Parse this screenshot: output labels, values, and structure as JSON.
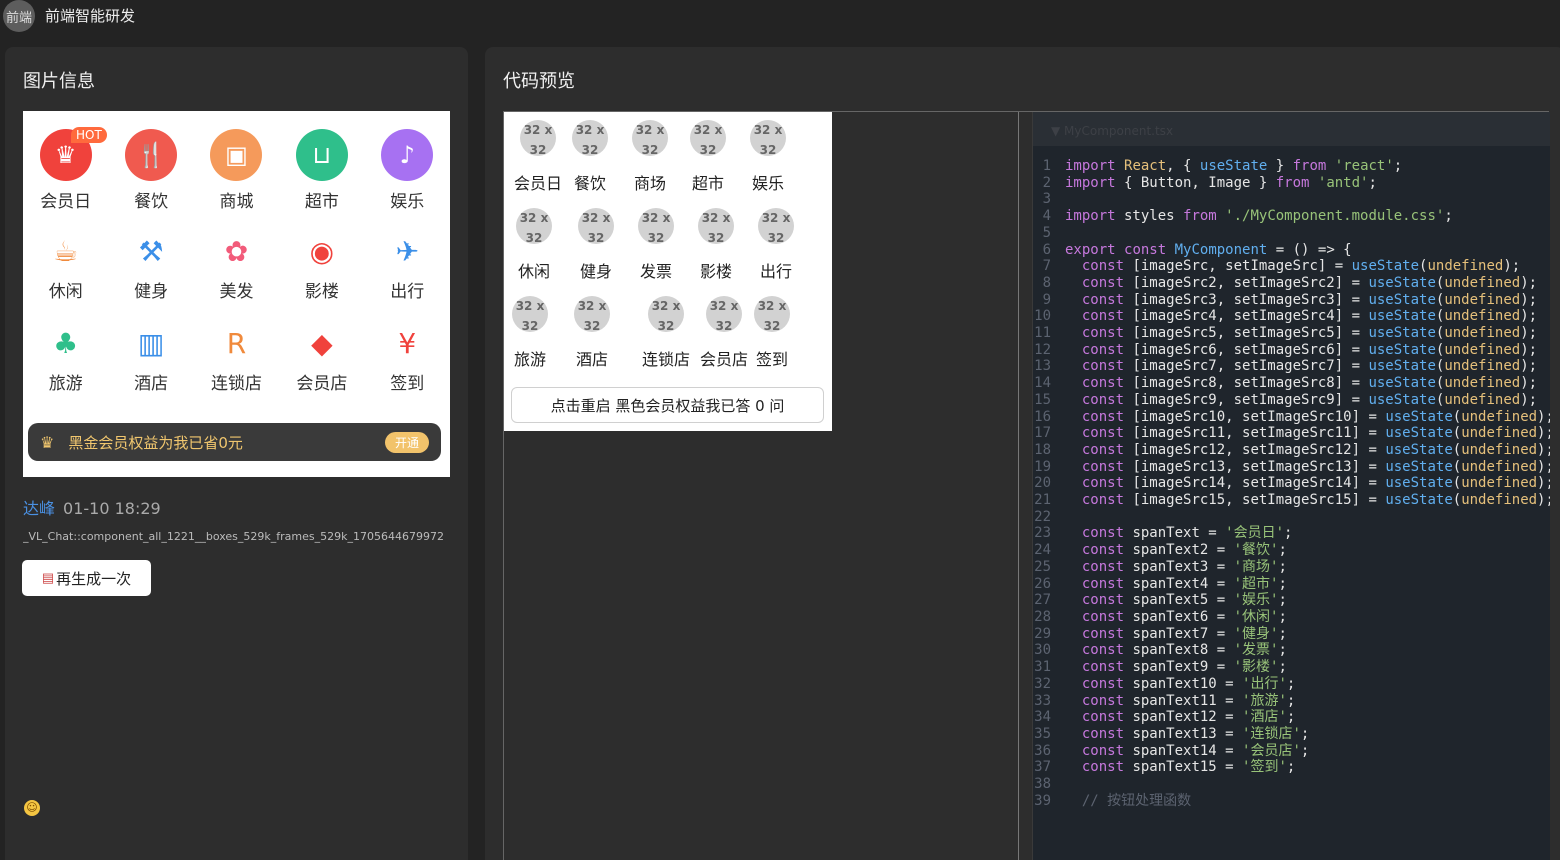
{
  "app": {
    "logo_text": "前端",
    "title": "前端智能研发"
  },
  "left_panel": {
    "title": "图片信息",
    "hot_badge": "HOT",
    "grid": [
      {
        "label": "会员日",
        "icon": "crown-icon",
        "color": "#f0423c",
        "glyph": "♛"
      },
      {
        "label": "餐饮",
        "icon": "fork-knife-icon",
        "color": "#f05a4f",
        "glyph": "🍴"
      },
      {
        "label": "商城",
        "icon": "shopping-bag-icon",
        "color": "#f59a5b",
        "glyph": "▣"
      },
      {
        "label": "超市",
        "icon": "basket-icon",
        "color": "#2fbf8b",
        "glyph": "⊔"
      },
      {
        "label": "娱乐",
        "icon": "microphone-icon",
        "color": "#a771f2",
        "glyph": "♪"
      },
      {
        "label": "休闲",
        "icon": "coffee-icon",
        "color": "#f08a3c",
        "glyph": "☕"
      },
      {
        "label": "健身",
        "icon": "dumbbell-icon",
        "color": "#3b8fe8",
        "glyph": "⚒"
      },
      {
        "label": "美发",
        "icon": "hair-icon",
        "color": "#f25b7a",
        "glyph": "✿"
      },
      {
        "label": "影楼",
        "icon": "camera-icon",
        "color": "#f0423c",
        "glyph": "◉"
      },
      {
        "label": "出行",
        "icon": "airplane-icon",
        "color": "#3b8fe8",
        "glyph": "✈"
      },
      {
        "label": "旅游",
        "icon": "palm-tree-icon",
        "color": "#2fbf8b",
        "glyph": "♣"
      },
      {
        "label": "酒店",
        "icon": "building-icon",
        "color": "#3b8fe8",
        "glyph": "▥"
      },
      {
        "label": "连锁店",
        "icon": "shield-r-icon",
        "color": "#f08a3c",
        "glyph": "R"
      },
      {
        "label": "会员店",
        "icon": "diamond-icon",
        "color": "#f0423c",
        "glyph": "◆"
      },
      {
        "label": "签到",
        "icon": "calendar-yen-icon",
        "color": "#f0423c",
        "glyph": "¥"
      }
    ],
    "vip_text": "黑金会员权益为我已省0元",
    "vip_button": "开通",
    "author": "达峰",
    "timestamp": "01-10 18:29",
    "session_id": "_VL_Chat::component_all_1221__boxes_529k_frames_529k_1705644679972",
    "regen_button": "再生成一次"
  },
  "right_panel": {
    "title": "代码预览",
    "placeholder_text": "32 x 32",
    "render_items": [
      "会员日",
      "餐饮",
      "商场",
      "超市",
      "娱乐",
      "休闲",
      "健身",
      "发票",
      "影楼",
      "出行",
      "旅游",
      "酒店",
      "连锁店",
      "会员店",
      "签到"
    ],
    "render_button": "点击重启 黑色会员权益我已答 0 问",
    "code_header": "▼ MyComponent.tsx",
    "code_lines": [
      "import React, { useState } from 'react';",
      "import { Button, Image } from 'antd';",
      "",
      "import styles from './MyComponent.module.css';",
      "",
      "export const MyComponent = () => {",
      "  const [imageSrc, setImageSrc] = useState(undefined);",
      "  const [imageSrc2, setImageSrc2] = useState(undefined);",
      "  const [imageSrc3, setImageSrc3] = useState(undefined);",
      "  const [imageSrc4, setImageSrc4] = useState(undefined);",
      "  const [imageSrc5, setImageSrc5] = useState(undefined);",
      "  const [imageSrc6, setImageSrc6] = useState(undefined);",
      "  const [imageSrc7, setImageSrc7] = useState(undefined);",
      "  const [imageSrc8, setImageSrc8] = useState(undefined);",
      "  const [imageSrc9, setImageSrc9] = useState(undefined);",
      "  const [imageSrc10, setImageSrc10] = useState(undefined);",
      "  const [imageSrc11, setImageSrc11] = useState(undefined);",
      "  const [imageSrc12, setImageSrc12] = useState(undefined);",
      "  const [imageSrc13, setImageSrc13] = useState(undefined);",
      "  const [imageSrc14, setImageSrc14] = useState(undefined);",
      "  const [imageSrc15, setImageSrc15] = useState(undefined);",
      "",
      "  const spanText = '会员日';",
      "  const spanText2 = '餐饮';",
      "  const spanText3 = '商场';",
      "  const spanText4 = '超市';",
      "  const spanText5 = '娱乐';",
      "  const spanText6 = '休闲';",
      "  const spanText7 = '健身';",
      "  const spanText8 = '发票';",
      "  const spanText9 = '影楼';",
      "  const spanText10 = '出行';",
      "  const spanText11 = '旅游';",
      "  const spanText12 = '酒店';",
      "  const spanText13 = '连锁店';",
      "  const spanText14 = '会员店';",
      "  const spanText15 = '签到';",
      "",
      "  // 按钮处理函数"
    ]
  }
}
